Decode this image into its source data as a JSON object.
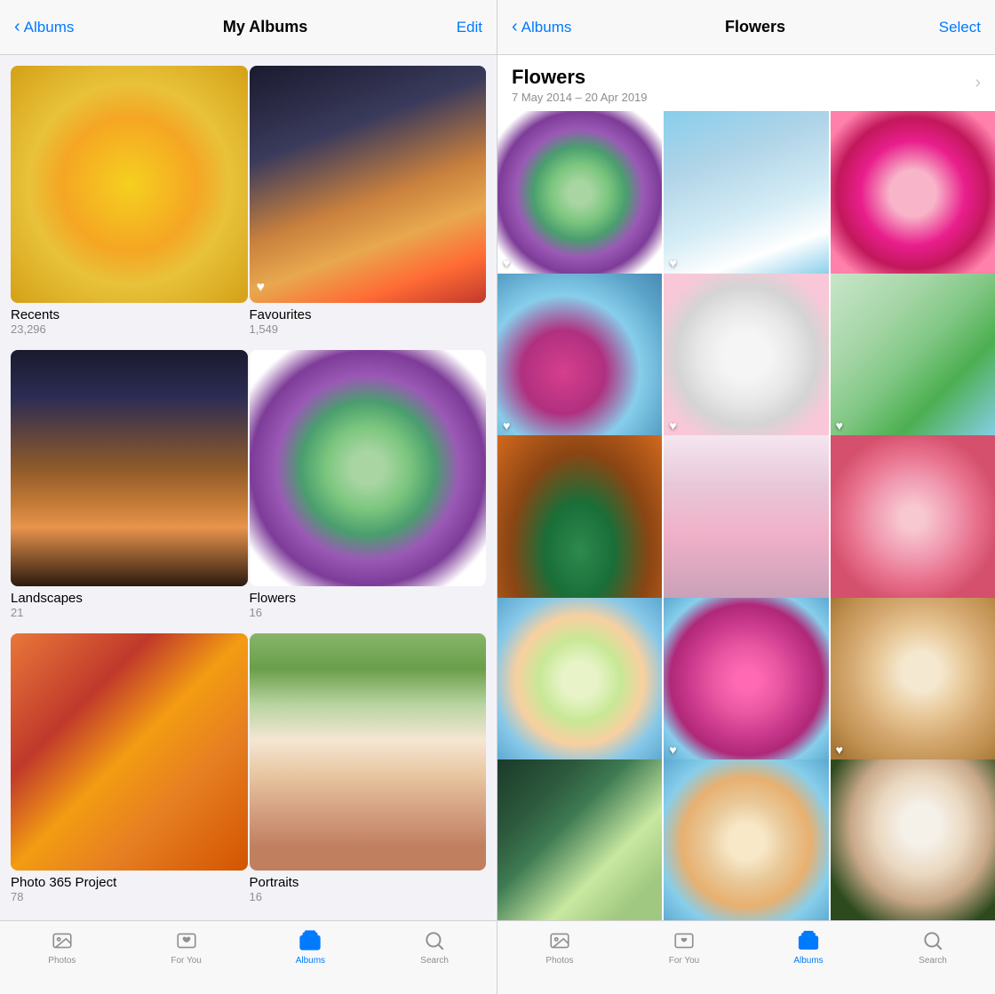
{
  "left": {
    "nav": {
      "back_label": "Albums",
      "title": "My Albums",
      "action_label": "Edit"
    },
    "albums": [
      {
        "id": "recents",
        "name": "Recents",
        "count": "23,296",
        "thumb_class": "thumb-recents",
        "has_heart": false
      },
      {
        "id": "favourites",
        "name": "Favourites",
        "count": "1,549",
        "thumb_class": "thumb-favourites",
        "has_heart": true
      },
      {
        "id": "landscapes",
        "name": "Landscapes",
        "count": "21",
        "thumb_class": "thumb-landscapes",
        "has_heart": false
      },
      {
        "id": "flowers",
        "name": "Flowers",
        "count": "16",
        "thumb_class": "thumb-flowers",
        "has_heart": false
      },
      {
        "id": "photo365",
        "name": "Photo 365 Project",
        "count": "78",
        "thumb_class": "thumb-photo365",
        "has_heart": false
      },
      {
        "id": "portraits",
        "name": "Portraits",
        "count": "16",
        "thumb_class": "thumb-portraits",
        "has_heart": false
      }
    ],
    "tab_bar": {
      "items": [
        {
          "id": "photos",
          "label": "Photos",
          "active": false
        },
        {
          "id": "for-you",
          "label": "For You",
          "active": false
        },
        {
          "id": "albums",
          "label": "Albums",
          "active": true
        },
        {
          "id": "search",
          "label": "Search",
          "active": false
        }
      ]
    }
  },
  "right": {
    "nav": {
      "back_label": "Albums",
      "title": "Flowers",
      "action_label": "Select"
    },
    "header": {
      "title": "Flowers",
      "date_range": "7 May 2014 – 20 Apr 2019"
    },
    "photos": [
      {
        "id": "p1",
        "thumb_class": "flower-1",
        "has_heart": true
      },
      {
        "id": "p2",
        "thumb_class": "flower-2",
        "has_heart": true
      },
      {
        "id": "p3",
        "thumb_class": "flower-3",
        "has_heart": false
      },
      {
        "id": "p4",
        "thumb_class": "flower-4",
        "has_heart": true
      },
      {
        "id": "p5",
        "thumb_class": "flower-5",
        "has_heart": false
      },
      {
        "id": "p6",
        "thumb_class": "flower-6",
        "has_heart": true
      },
      {
        "id": "p7",
        "thumb_class": "flower-7",
        "has_heart": false
      },
      {
        "id": "p8",
        "thumb_class": "flower-8",
        "has_heart": false
      },
      {
        "id": "p9",
        "thumb_class": "flower-9",
        "has_heart": false
      },
      {
        "id": "p10",
        "thumb_class": "flower-10",
        "has_heart": false
      },
      {
        "id": "p11",
        "thumb_class": "flower-11",
        "has_heart": true
      },
      {
        "id": "p12",
        "thumb_class": "flower-12",
        "has_heart": true
      },
      {
        "id": "p13",
        "thumb_class": "flower-13",
        "has_heart": false
      },
      {
        "id": "p14",
        "thumb_class": "flower-14",
        "has_heart": false
      },
      {
        "id": "p15",
        "thumb_class": "flower-15",
        "has_heart": false
      }
    ],
    "tab_bar": {
      "items": [
        {
          "id": "photos",
          "label": "Photos",
          "active": false
        },
        {
          "id": "for-you",
          "label": "For You",
          "active": false
        },
        {
          "id": "albums",
          "label": "Albums",
          "active": true
        },
        {
          "id": "search",
          "label": "Search",
          "active": false
        }
      ]
    }
  }
}
